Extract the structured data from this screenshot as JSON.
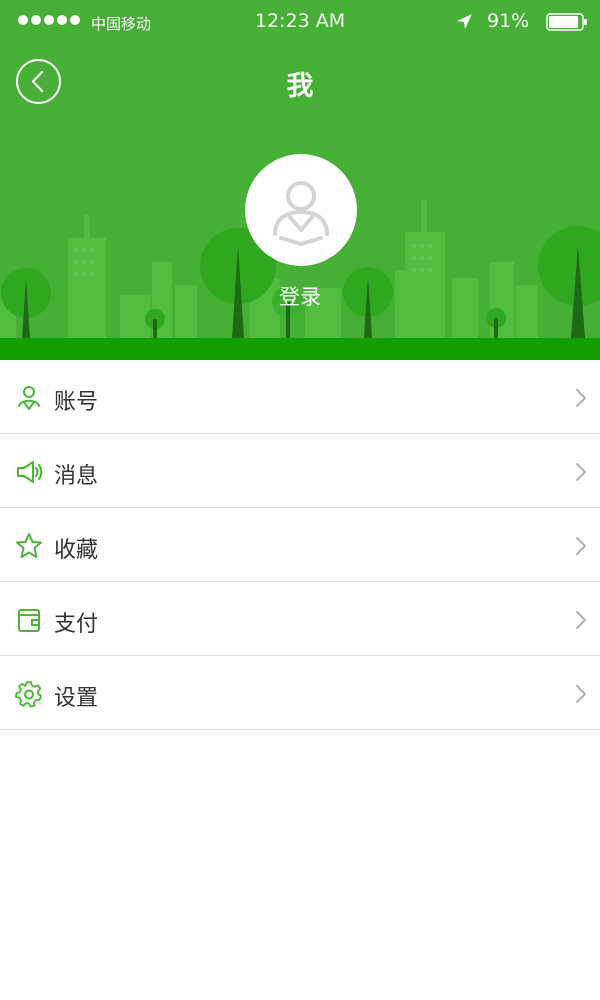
{
  "status_bar": {
    "carrier": "中国移动",
    "time": "12:23 AM",
    "battery_percent": "91%",
    "battery_level": 0.91,
    "signal_bars": 5
  },
  "nav": {
    "title": "我",
    "back_icon": "chevron-left-circle-icon"
  },
  "profile": {
    "avatar_icon": "user-icon",
    "login_label": "登录"
  },
  "menu": {
    "items": [
      {
        "label": "账号",
        "icon": "account-icon"
      },
      {
        "label": "消息",
        "icon": "speaker-icon"
      },
      {
        "label": "收藏",
        "icon": "star-icon"
      },
      {
        "label": "支付",
        "icon": "wallet-icon"
      },
      {
        "label": "设置",
        "icon": "gear-icon"
      }
    ]
  },
  "colors": {
    "brand_green": "#45b035",
    "ground_green": "#12a000",
    "icon_green": "#4cb53a",
    "chevron_gray": "#b3b3b3",
    "text": "#333333"
  }
}
